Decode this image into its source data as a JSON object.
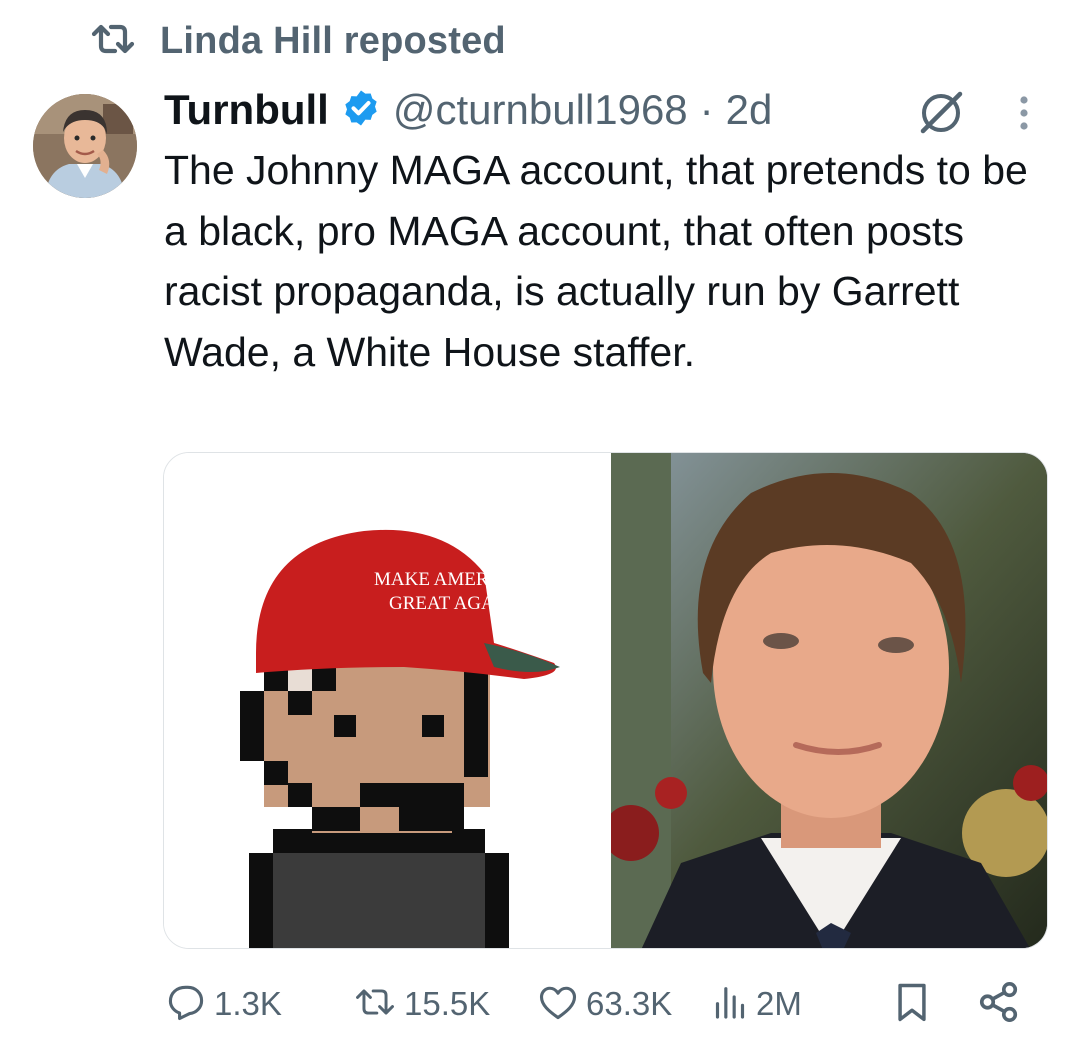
{
  "repost": {
    "label": "Linda Hill reposted",
    "icon": "repost-icon"
  },
  "tweet": {
    "author_name": "Turnbull",
    "verified_icon": "verified-badge-icon",
    "handle": "@cturnbull1968",
    "separator": "·",
    "time": "2d",
    "text": "The Johnny MAGA account, that pretends to be a black, pro MAGA account, that often posts racist propaganda, is actually run by Garrett Wade, a White House staffer.",
    "media": {
      "left_image": "pixel-art avatar",
      "hat_text_line1": "MAKE AMERICA",
      "hat_text_line2": "GREAT AGAIN",
      "right_image": "photo of man"
    },
    "actions": {
      "replies": "1.3K",
      "reposts": "15.5K",
      "likes": "63.3K",
      "views": "2M"
    }
  },
  "colors": {
    "muted": "#536471",
    "text": "#0f1419",
    "verified": "#1d9bf0",
    "hat_red": "#c81e1e"
  }
}
